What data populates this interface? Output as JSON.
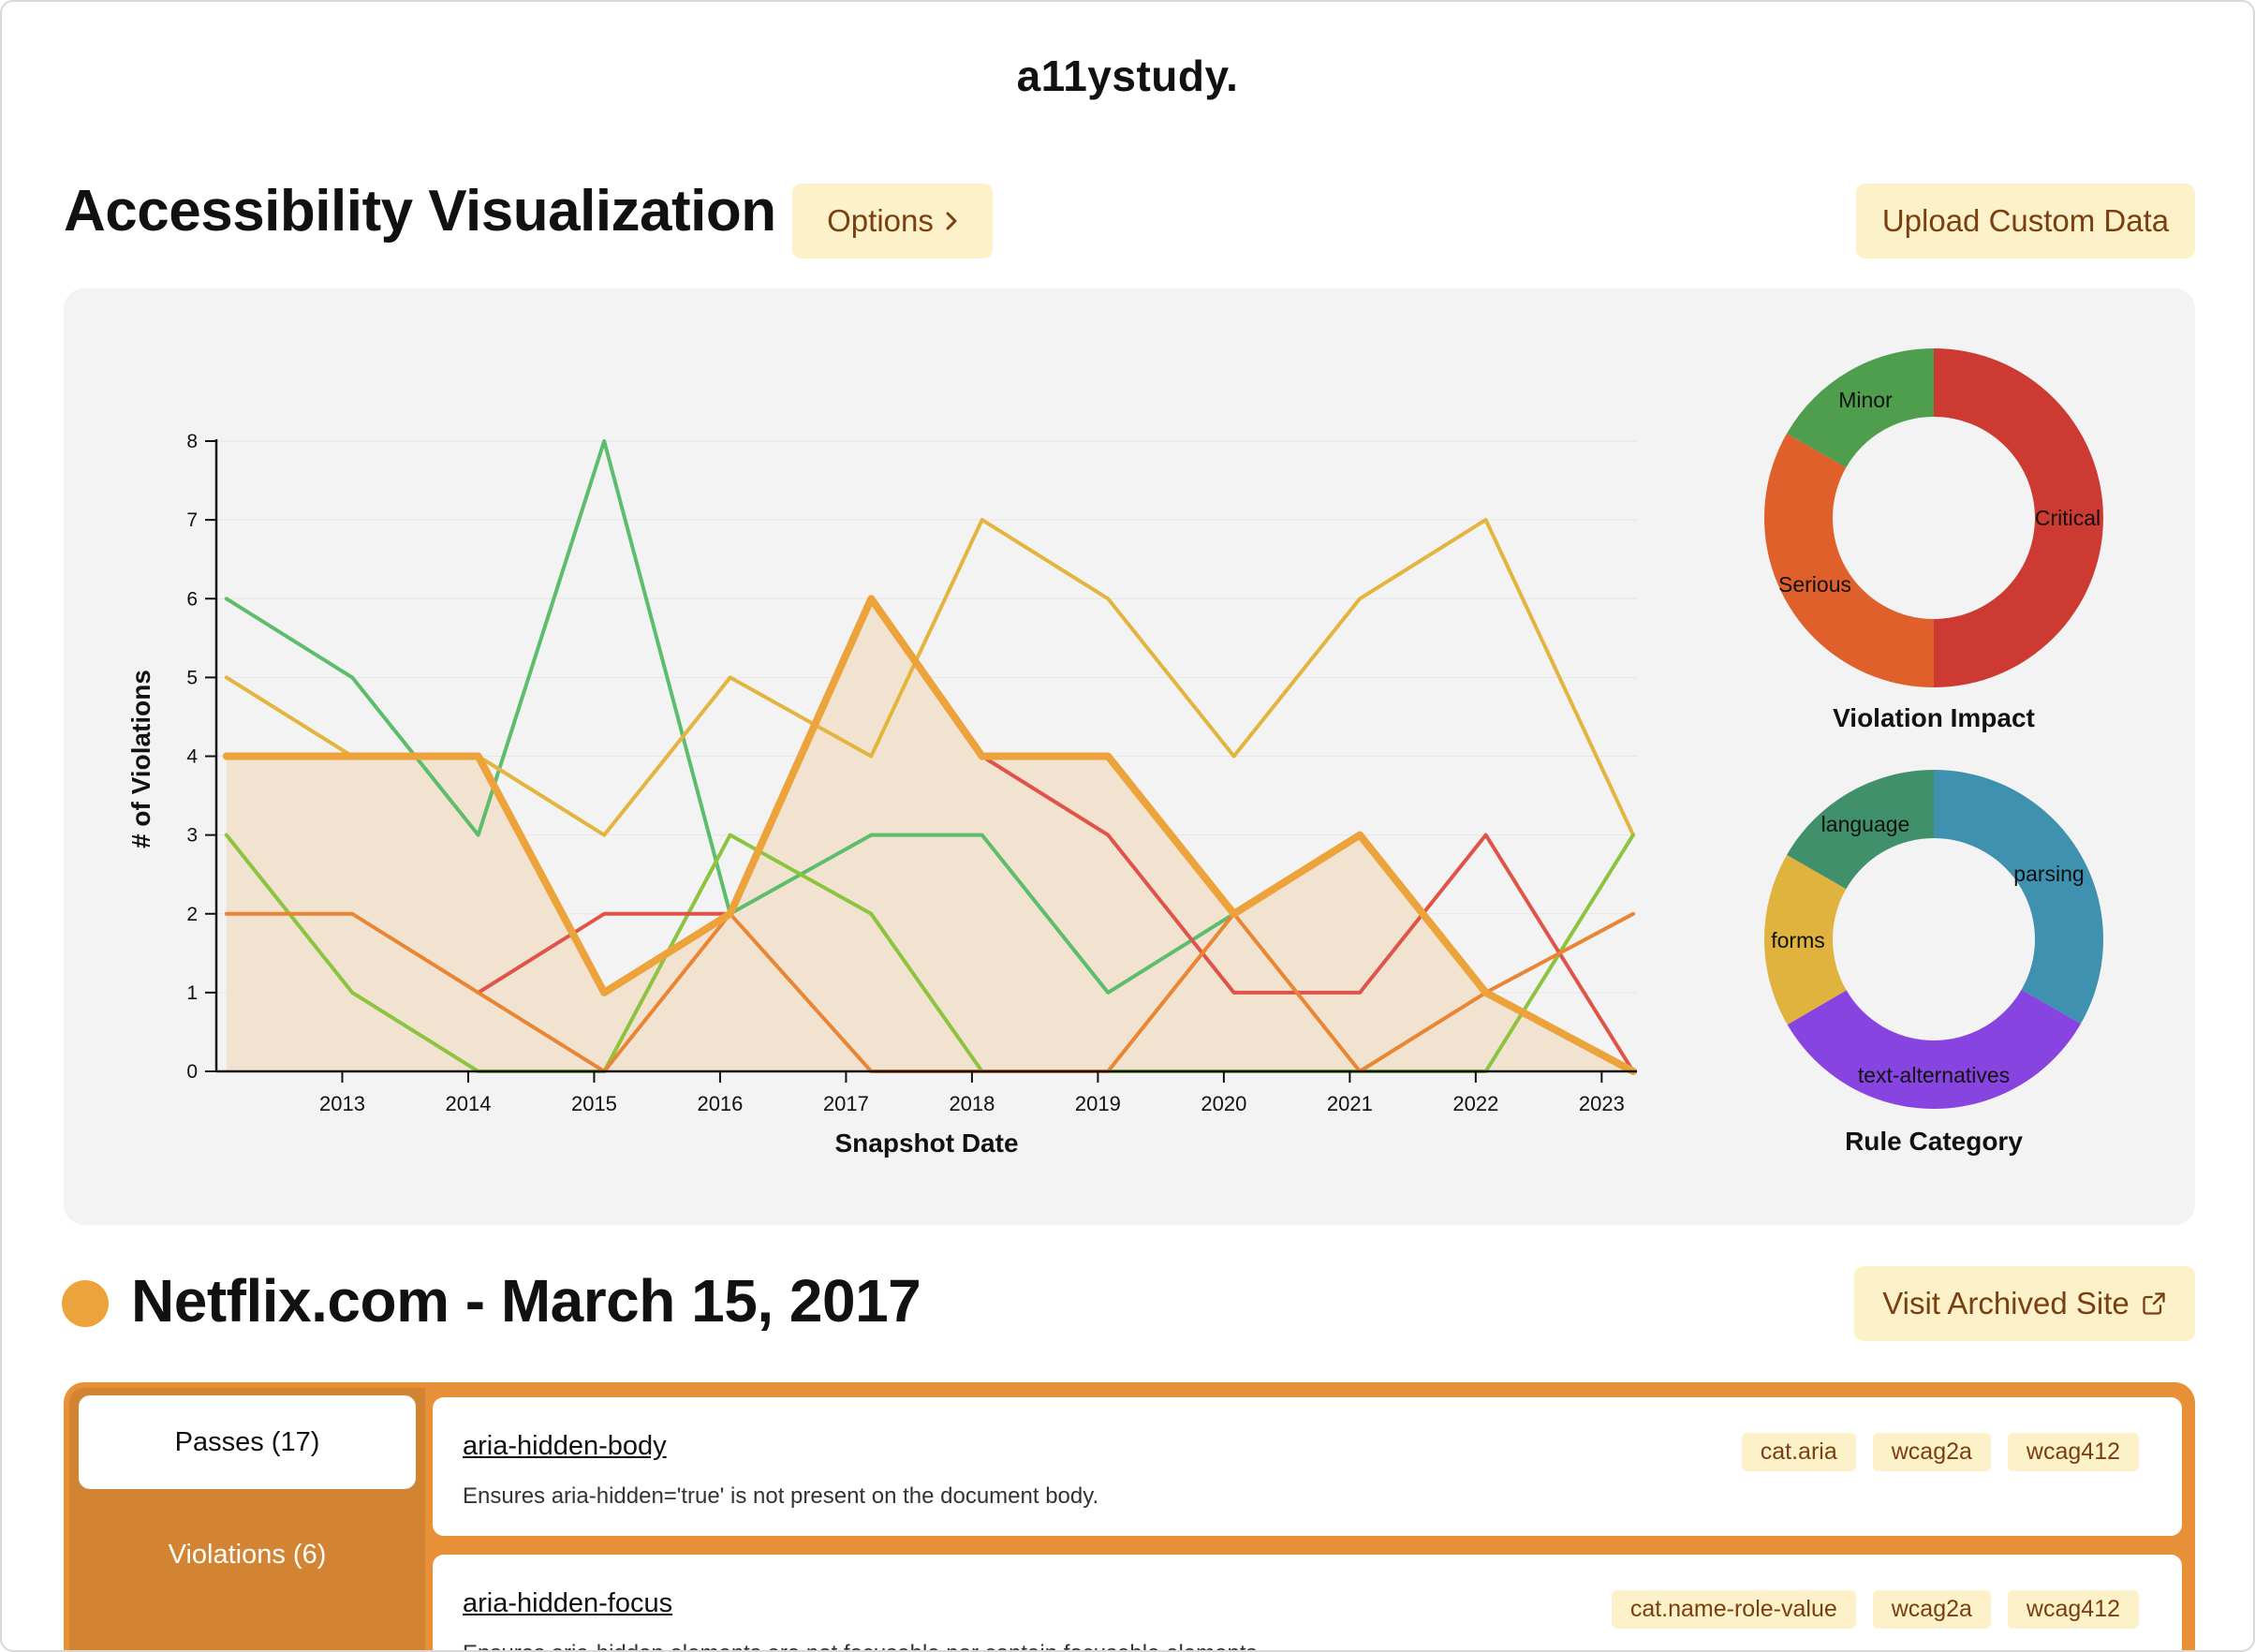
{
  "app": {
    "brand": "a11ystudy."
  },
  "header": {
    "title": "Accessibility Visualization",
    "options_label": "Options",
    "upload_label": "Upload Custom Data"
  },
  "colors": {
    "button_bg": "#fdf1c9",
    "button_text": "#7a3f10",
    "accent_orange": "#e89038",
    "highlight_fill": "#f2e2d0"
  },
  "chart_data": [
    {
      "type": "line",
      "xlabel": "Snapshot Date",
      "ylabel": "# of Violations",
      "x": [
        2012.08,
        2013.08,
        2014.08,
        2015.08,
        2016.08,
        2017.2,
        2018.08,
        2019.08,
        2020.08,
        2021.08,
        2022.08,
        2023.25
      ],
      "xlim": [
        2012.0,
        2023.28
      ],
      "ylim": [
        0,
        8
      ],
      "x_ticks": [
        "2013",
        "2014",
        "2015",
        "2016",
        "2017",
        "2018",
        "2019",
        "2020",
        "2021",
        "2022",
        "2023"
      ],
      "y_ticks": [
        "0",
        "1",
        "2",
        "3",
        "4",
        "5",
        "6",
        "7",
        "8"
      ],
      "grid": true,
      "highlighted_series": 5,
      "series": [
        {
          "color": "#5cbd6a",
          "values": [
            6,
            5,
            3,
            8,
            2,
            3,
            3,
            1,
            2,
            null,
            null,
            null
          ]
        },
        {
          "color": "#e3b53f",
          "values": [
            5,
            4,
            4,
            3,
            5,
            4,
            7,
            6,
            4,
            6,
            7,
            3
          ]
        },
        {
          "color": "#8cc43f",
          "values": [
            3,
            1,
            0,
            0,
            3,
            2,
            0,
            0,
            0,
            0,
            0,
            3
          ]
        },
        {
          "color": "#df5349",
          "values": [
            null,
            null,
            1,
            2,
            2,
            6,
            4,
            3,
            1,
            1,
            3,
            0
          ]
        },
        {
          "color": "#ea8533",
          "values": [
            2,
            2,
            1,
            0,
            2,
            0,
            0,
            0,
            2,
            0,
            1,
            2
          ]
        },
        {
          "color": "#eda33b",
          "values": [
            4,
            4,
            4,
            1,
            2,
            6,
            4,
            4,
            2,
            3,
            1,
            0
          ]
        }
      ]
    },
    {
      "type": "pie",
      "title": "Violation Impact",
      "slices": [
        {
          "label": "Critical",
          "value": 50,
          "color": "#cd3a32"
        },
        {
          "label": "Serious",
          "value": 33.3,
          "color": "#df602b"
        },
        {
          "label": "Minor",
          "value": 16.7,
          "color": "#4f9e4e"
        }
      ]
    },
    {
      "type": "pie",
      "title": "Rule Category",
      "slices": [
        {
          "label": "parsing",
          "value": 33.3,
          "color": "#3f91b0"
        },
        {
          "label": "text-alternatives",
          "value": 33.3,
          "color": "#8744e0"
        },
        {
          "label": "forms",
          "value": 16.7,
          "color": "#e0b23e"
        },
        {
          "label": "language",
          "value": 16.7,
          "color": "#40906c"
        }
      ]
    }
  ],
  "site": {
    "title": "Netflix.com - March 15, 2017",
    "visit_label": "Visit Archived Site",
    "dot_color": "#eda33b"
  },
  "tabs": {
    "passes": "Passes (17)",
    "violations": "Violations (6)"
  },
  "rules": [
    {
      "name": "aria-hidden-body",
      "description": "Ensures aria-hidden='true' is not present on the document body.",
      "tags": [
        "cat.aria",
        "wcag2a",
        "wcag412"
      ]
    },
    {
      "name": "aria-hidden-focus",
      "description": "Ensures aria-hidden elements are not focusable nor contain focusable elements.",
      "tags": [
        "cat.name-role-value",
        "wcag2a",
        "wcag412"
      ]
    }
  ]
}
